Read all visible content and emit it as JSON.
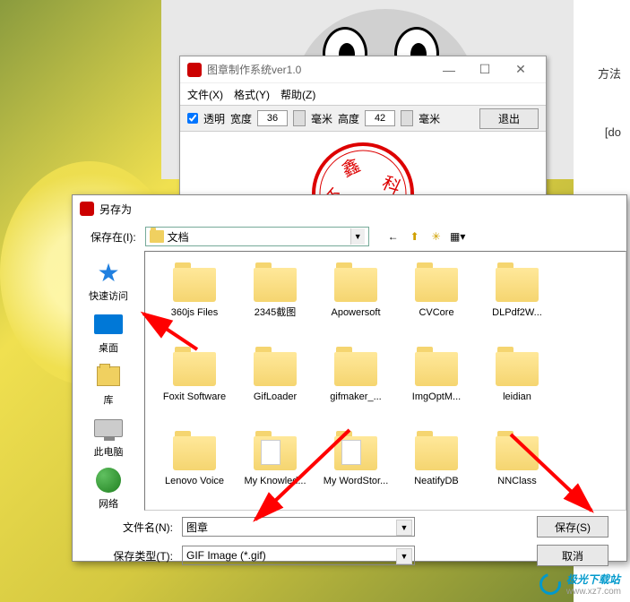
{
  "stamp_window": {
    "title": "图章制作系统ver1.0",
    "menu": {
      "file": "文件(X)",
      "format": "格式(Y)",
      "help": "帮助(Z)"
    },
    "toolbar": {
      "transparent": "透明",
      "width_label": "宽度",
      "width_value": "36",
      "mm1": "毫米",
      "height_label": "高度",
      "height_value": "42",
      "mm2": "毫米",
      "exit": "退出"
    }
  },
  "saveas": {
    "title": "另存为",
    "savein_label": "保存在(I):",
    "savein_value": "文档",
    "places": {
      "quick": "快速访问",
      "desktop": "桌面",
      "library": "库",
      "thispc": "此电脑",
      "network": "网络"
    },
    "files": [
      "360js Files",
      "2345截图",
      "Apowersoft",
      "CVCore",
      "DLPdf2W...",
      "Foxit Software",
      "GifLoader",
      "gifmaker_...",
      "ImgOptM...",
      "leidian",
      "Lenovo Voice",
      "My Knowled...",
      "My WordStor...",
      "NeatifyDB",
      "NNClass"
    ],
    "filename_label": "文件名(N):",
    "filename_value": "图章",
    "filetype_label": "保存类型(T):",
    "filetype_value": "GIF Image (*.gif)",
    "save_btn": "保存(S)",
    "cancel_btn": "取消"
  },
  "side": {
    "t1": "方法",
    "t2": "[do"
  },
  "watermark": {
    "name": "极光下载站",
    "url": "www.xz7.com"
  }
}
